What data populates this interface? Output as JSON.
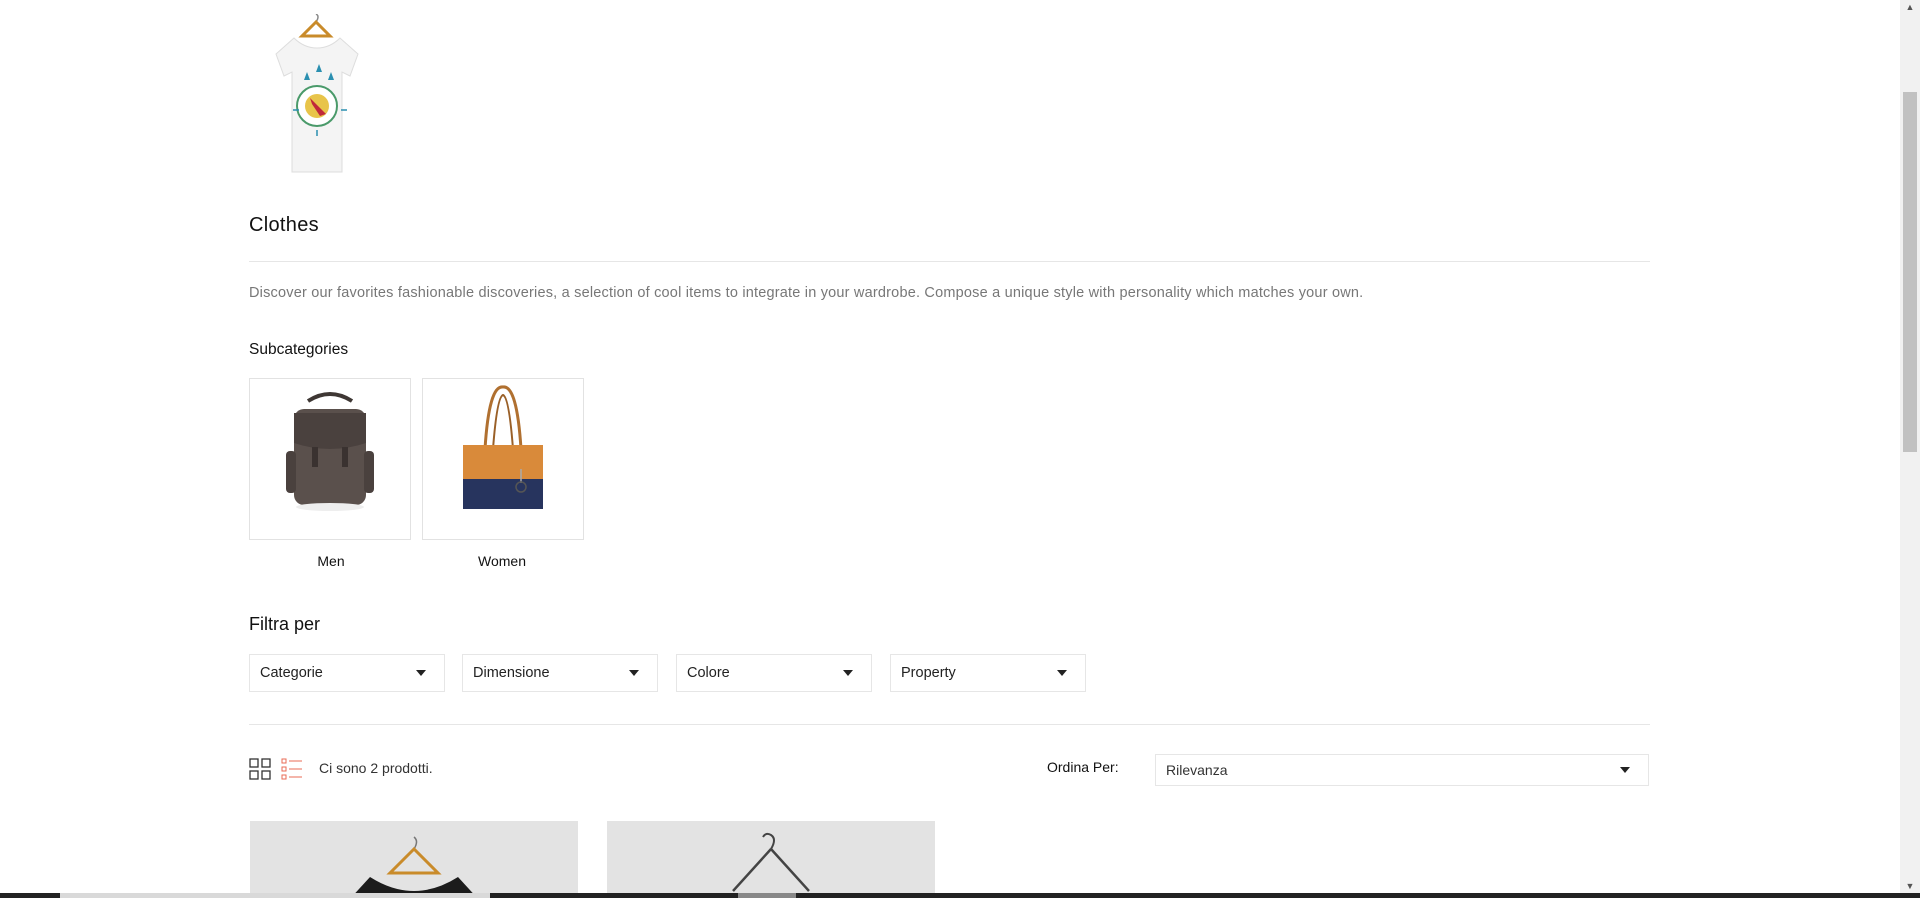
{
  "category": {
    "title": "Clothes",
    "description": "Discover our favorites fashionable discoveries, a selection of cool items to integrate in your wardrobe. Compose a unique style with personality which matches your own.",
    "image_icon": "tshirt-on-hanger-image"
  },
  "subcategories": {
    "heading": "Subcategories",
    "items": [
      {
        "label": "Men",
        "image_icon": "backpack-image"
      },
      {
        "label": "Women",
        "image_icon": "tote-bag-image"
      }
    ]
  },
  "filters": {
    "heading": "Filtra per",
    "dropdowns": [
      {
        "label": "Categorie"
      },
      {
        "label": "Dimensione"
      },
      {
        "label": "Colore"
      },
      {
        "label": "Property"
      }
    ]
  },
  "listing": {
    "count_text": "Ci sono 2 prodotti.",
    "sort_label": "Ordina Per:",
    "sort_value": "Rilevanza",
    "view_icons": [
      "grid-view-icon",
      "list-view-icon"
    ]
  },
  "colors": {
    "accent": "#e96b56",
    "border": "#e6e6e6",
    "text_muted": "#777777"
  }
}
